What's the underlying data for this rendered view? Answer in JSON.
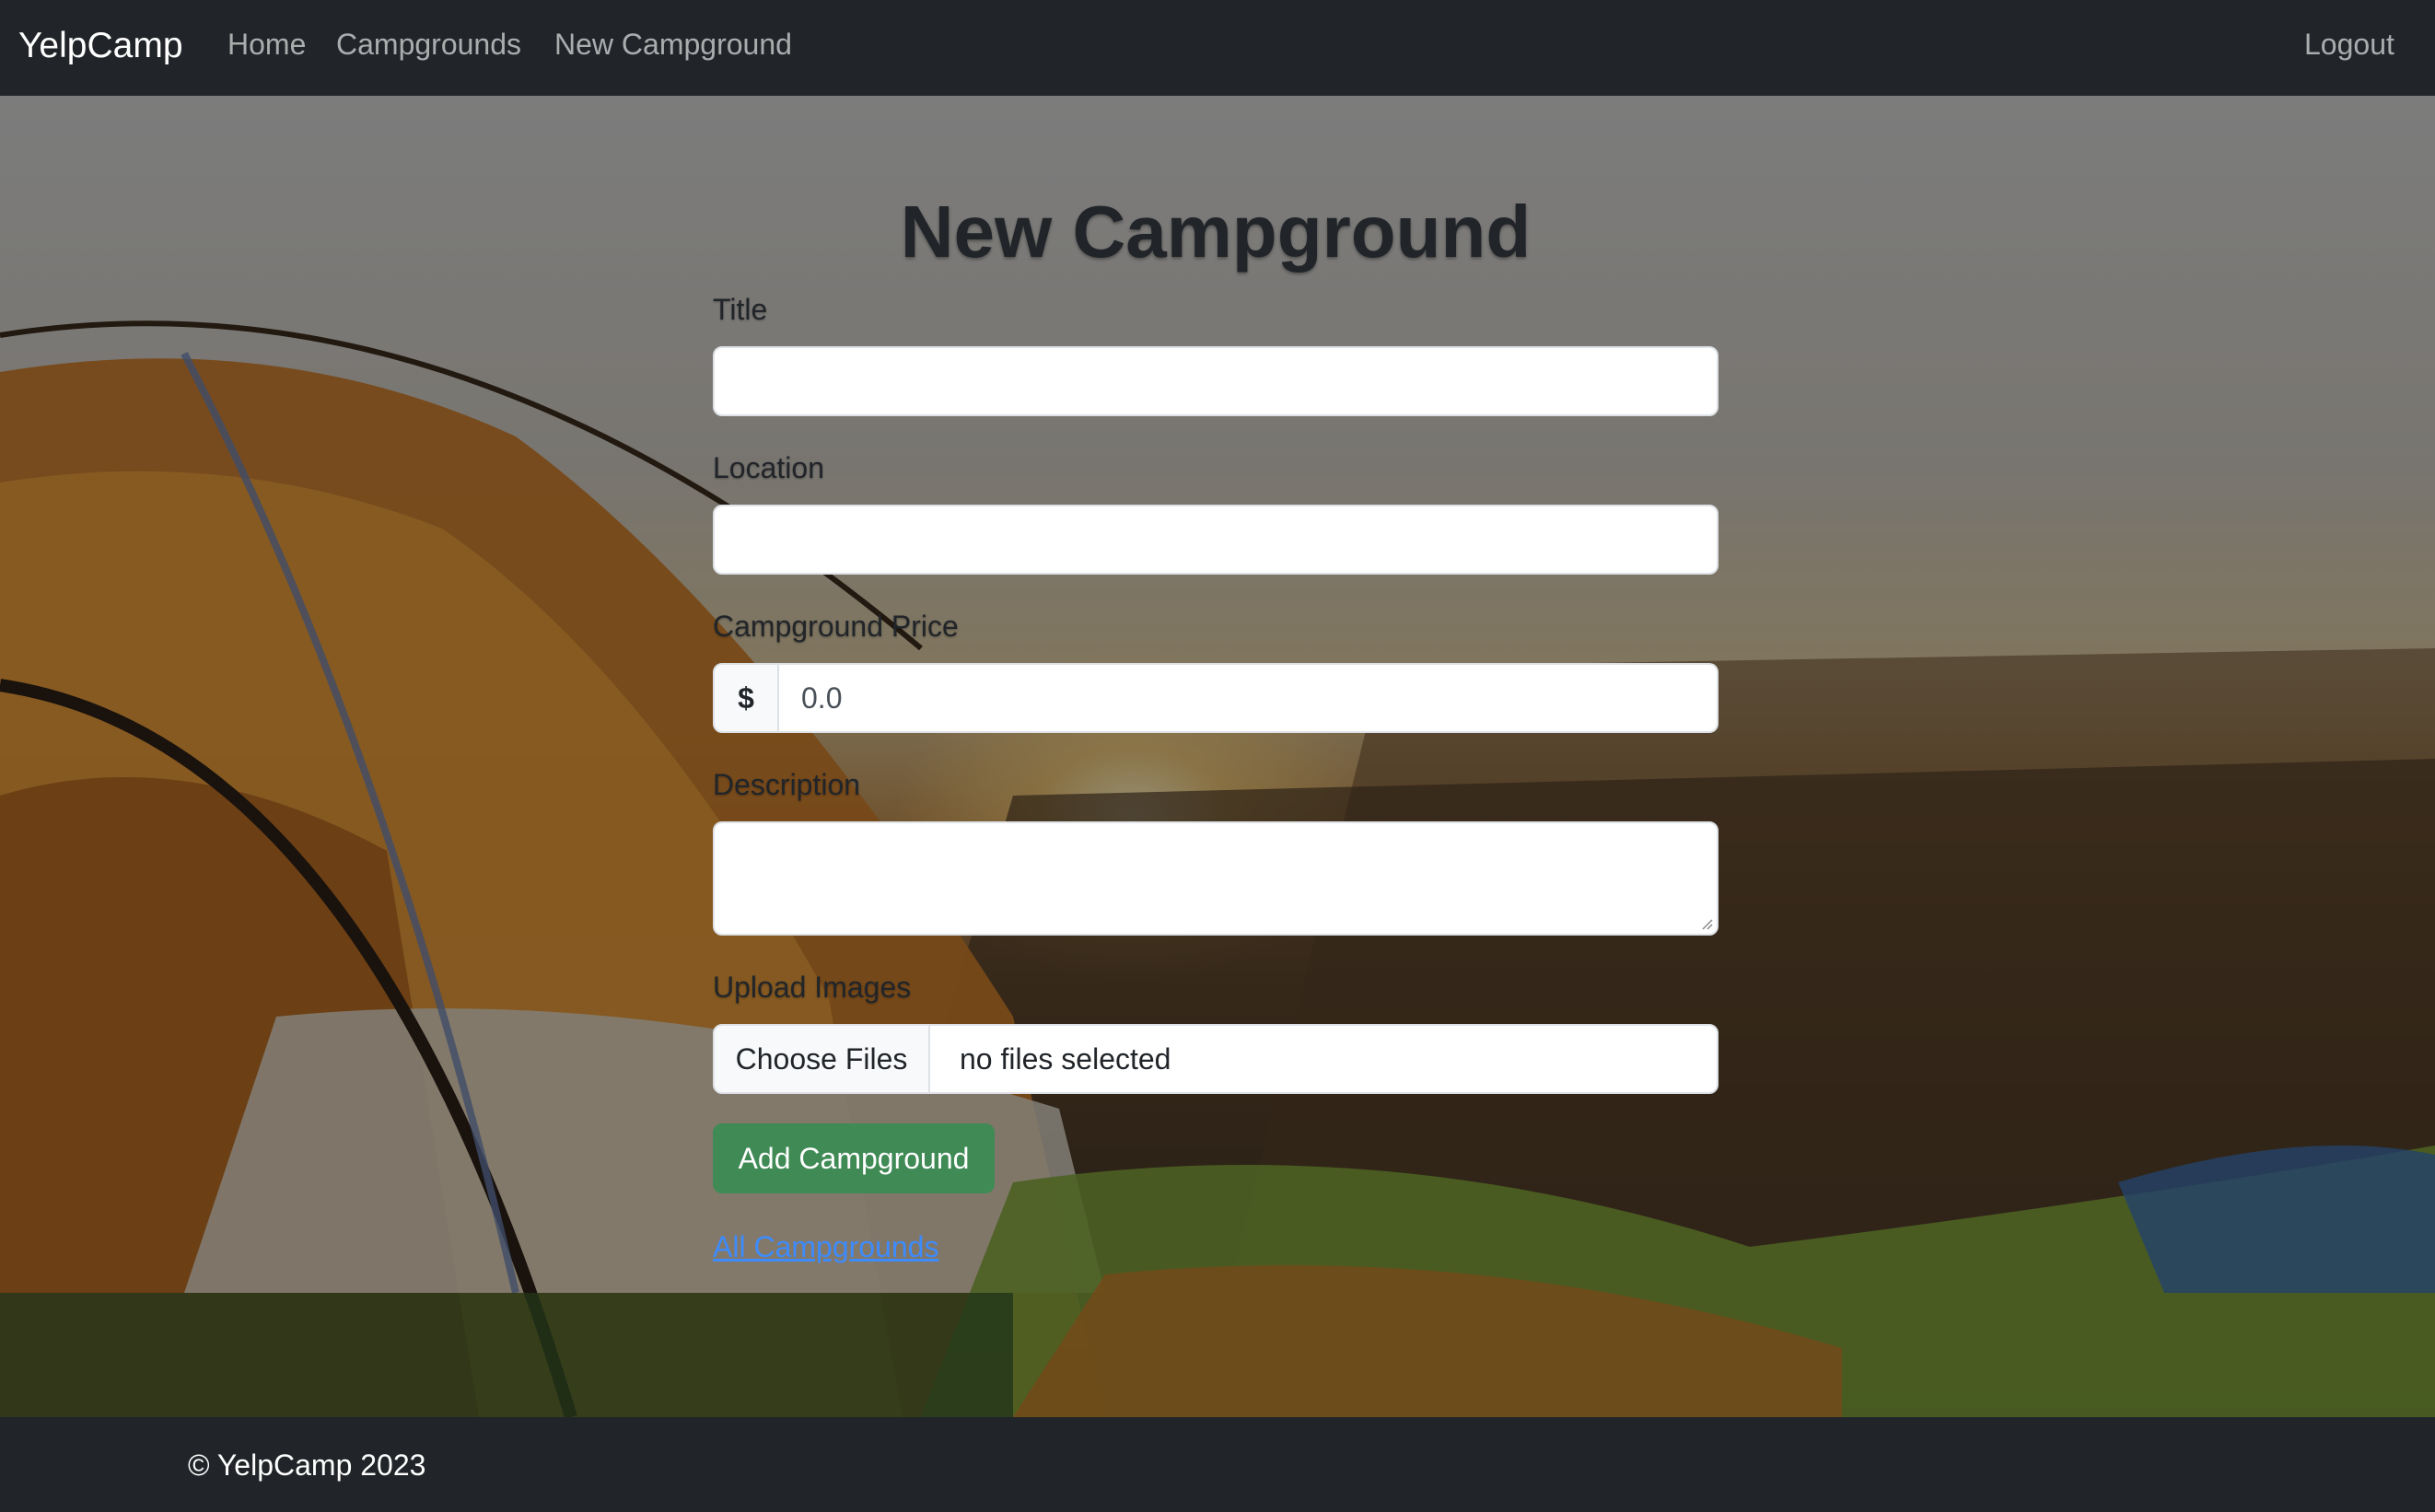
{
  "navbar": {
    "brand": "YelpCamp",
    "links": {
      "home": "Home",
      "campgrounds": "Campgrounds",
      "new_campground": "New Campground"
    },
    "logout": "Logout"
  },
  "form": {
    "heading": "New Campground",
    "title": {
      "label": "Title",
      "value": ""
    },
    "location": {
      "label": "Location",
      "value": ""
    },
    "price": {
      "label": "Campground Price",
      "currency_symbol": "$",
      "placeholder": "0.0"
    },
    "description": {
      "label": "Description",
      "value": ""
    },
    "images": {
      "label": "Upload Images",
      "button": "Choose Files",
      "status": "no files selected"
    },
    "submit_label": "Add Campground",
    "back_link": "All Campgrounds"
  },
  "footer": {
    "copyright": "© YelpCamp 2023"
  },
  "colors": {
    "navbar_bg": "#212529",
    "submit_bg": "#3f8a55",
    "link": "#3d8bfd"
  },
  "background": {
    "scene": "tent-at-sunset-photo"
  }
}
